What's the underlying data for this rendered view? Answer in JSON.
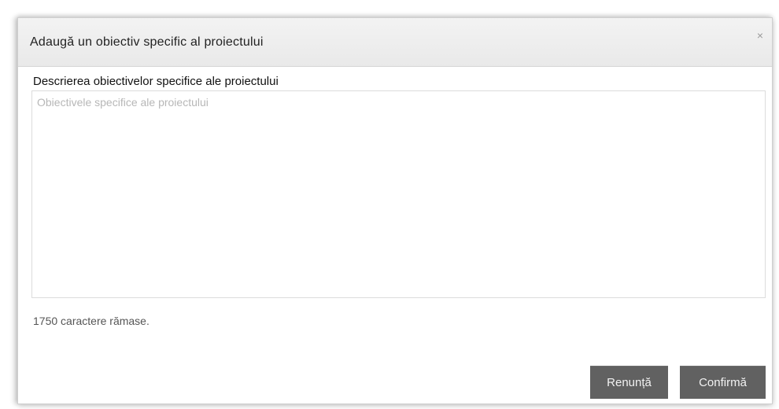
{
  "dialog": {
    "title": "Adaugă un obiectiv specific al proiectului",
    "close_symbol": "×",
    "close_icon": "close-icon"
  },
  "form": {
    "label": "Descrierea obiectivelor specifice ale proiectului",
    "value": "",
    "placeholder": "Obiectivele specifice ale proiectului",
    "chars_remaining": "1750 caractere rămase."
  },
  "actions": {
    "cancel_label": "Renunță",
    "confirm_label": "Confirmă"
  }
}
